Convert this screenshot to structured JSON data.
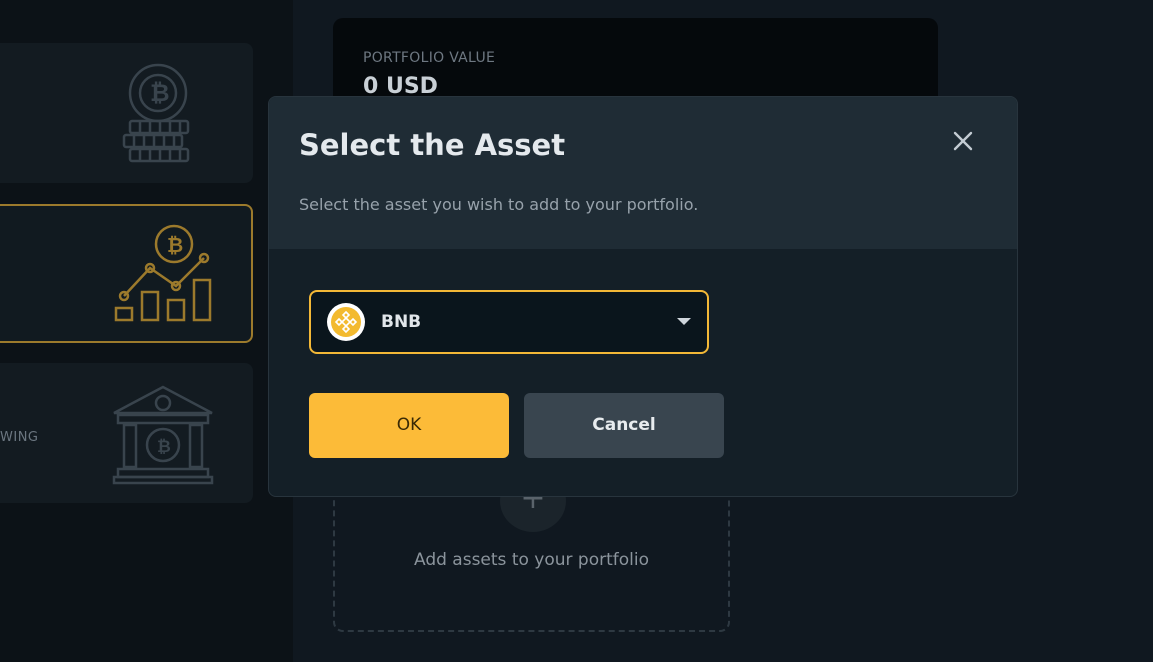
{
  "background": {
    "cards": [
      {
        "label": ""
      },
      {
        "label": ""
      },
      {
        "label": "WING"
      }
    ],
    "portfolio": {
      "label": "PORTFOLIO VALUE",
      "value": "0 USD"
    },
    "empty_state": {
      "add_symbol": "+",
      "text": "Add assets to your portfolio"
    }
  },
  "modal": {
    "title": "Select the Asset",
    "subtitle": "Select the asset you wish to add to your portfolio.",
    "close_icon": "close-icon",
    "select": {
      "value": "BNB",
      "icon": "bnb-coin-icon"
    },
    "ok_label": "OK",
    "cancel_label": "Cancel"
  },
  "colors": {
    "accent": "#fcbb38",
    "highlight_border": "#9c7a2c",
    "select_border": "#f3b837"
  }
}
